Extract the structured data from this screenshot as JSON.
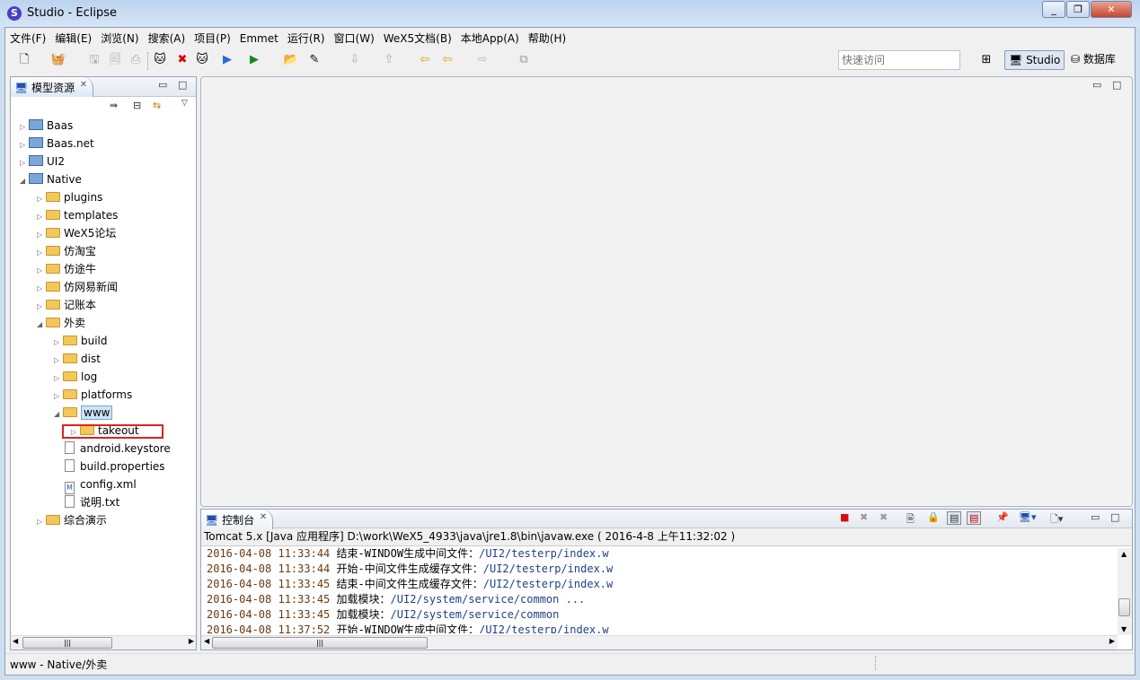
{
  "window": {
    "title": "Studio - Eclipse",
    "app_icon": "S"
  },
  "menu": [
    "文件(F)",
    "编辑(E)",
    "浏览(N)",
    "搜索(A)",
    "项目(P)",
    "Emmet",
    "运行(R)",
    "窗口(W)",
    "WeX5文档(B)",
    "本地App(A)",
    "帮助(H)"
  ],
  "toolbar": {
    "quick_access_placeholder": "快速访问",
    "perspectives": [
      "Studio",
      "数据库"
    ]
  },
  "explorer": {
    "tab": "模型资源",
    "tree": [
      {
        "label": "Baas",
        "level": 0,
        "type": "project",
        "state": "collapsed"
      },
      {
        "label": "Baas.net",
        "level": 0,
        "type": "project",
        "state": "collapsed"
      },
      {
        "label": "UI2",
        "level": 0,
        "type": "project",
        "state": "collapsed"
      },
      {
        "label": "Native",
        "level": 0,
        "type": "project",
        "state": "expanded"
      },
      {
        "label": "plugins",
        "level": 1,
        "type": "folder",
        "state": "collapsed"
      },
      {
        "label": "templates",
        "level": 1,
        "type": "folder",
        "state": "collapsed"
      },
      {
        "label": "WeX5论坛",
        "level": 1,
        "type": "folder",
        "state": "collapsed"
      },
      {
        "label": "仿淘宝",
        "level": 1,
        "type": "folder",
        "state": "collapsed"
      },
      {
        "label": "仿途牛",
        "level": 1,
        "type": "folder",
        "state": "collapsed"
      },
      {
        "label": "仿网易新闻",
        "level": 1,
        "type": "folder",
        "state": "collapsed"
      },
      {
        "label": "记账本",
        "level": 1,
        "type": "folder",
        "state": "collapsed"
      },
      {
        "label": "外卖",
        "level": 1,
        "type": "folder",
        "state": "expanded"
      },
      {
        "label": "build",
        "level": 2,
        "type": "folder",
        "state": "collapsed"
      },
      {
        "label": "dist",
        "level": 2,
        "type": "folder",
        "state": "collapsed"
      },
      {
        "label": "log",
        "level": 2,
        "type": "folder",
        "state": "collapsed"
      },
      {
        "label": "platforms",
        "level": 2,
        "type": "folder",
        "state": "collapsed"
      },
      {
        "label": "www",
        "level": 2,
        "type": "folder",
        "state": "expanded",
        "selected": true
      },
      {
        "label": "takeout",
        "level": 3,
        "type": "folder",
        "state": "collapsed",
        "highlighted": true
      },
      {
        "label": "android.keystore",
        "level": 2,
        "type": "file"
      },
      {
        "label": "build.properties",
        "level": 2,
        "type": "file"
      },
      {
        "label": "config.xml",
        "level": 2,
        "type": "file",
        "glyph": "M"
      },
      {
        "label": "说明.txt",
        "level": 2,
        "type": "file"
      },
      {
        "label": "综合演示",
        "level": 1,
        "type": "folder",
        "state": "collapsed"
      }
    ]
  },
  "console": {
    "tab": "控制台",
    "process": "Tomcat 5.x [Java 应用程序] D:\\work\\WeX5_4933\\java\\jre1.8\\bin\\javaw.exe ( 2016-4-8 上午11:32:02 )",
    "lines": [
      {
        "ts": "2016-04-08 11:33:44",
        "msg": "结束-WINDOW生成中间文件：",
        "path": "/UI2/testerp/index.w"
      },
      {
        "ts": "2016-04-08 11:33:44",
        "msg": "开始-中间文件生成缓存文件：",
        "path": "/UI2/testerp/index.w"
      },
      {
        "ts": "2016-04-08 11:33:45",
        "msg": "结束-中间文件生成缓存文件：",
        "path": "/UI2/testerp/index.w"
      },
      {
        "ts": "2016-04-08 11:33:45",
        "msg": "加载模块：",
        "path": "/UI2/system/service/common ..."
      },
      {
        "ts": "2016-04-08 11:33:45",
        "msg": "加载模块：",
        "path": "/UI2/system/service/common"
      },
      {
        "ts": "2016-04-08 11:37:52",
        "msg": "开始-WINDOW生成中间文件：",
        "path": "/UI2/testerp/index.w"
      }
    ]
  },
  "status": {
    "text": "www - Native/外卖"
  },
  "colors": {
    "highlight_box": "#e02020",
    "selection": "#cce4f7"
  }
}
